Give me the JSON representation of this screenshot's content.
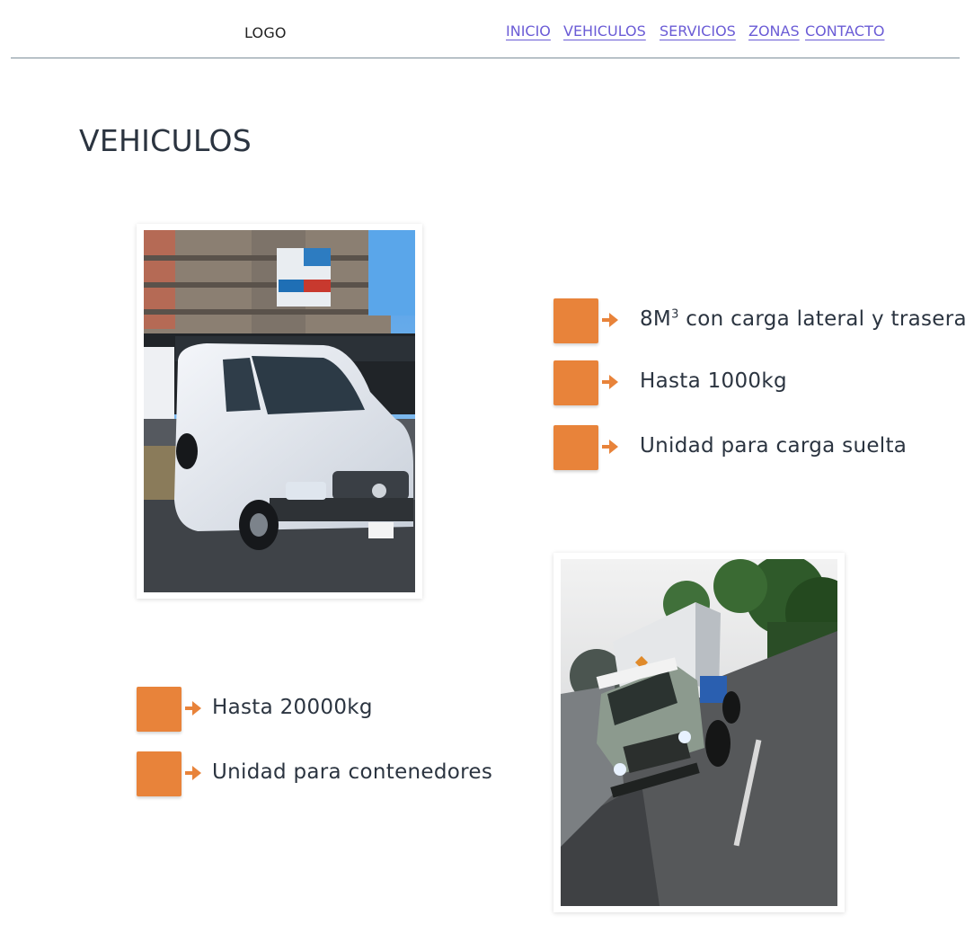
{
  "header": {
    "logo": "LOGO",
    "nav": [
      "INICIO",
      "VEHICULOS",
      "SERVICIOS",
      "ZONAS",
      "CONTACTO"
    ]
  },
  "main": {
    "title": "VEHICULOS",
    "vehicle1": {
      "features": [
        {
          "base": "8M",
          "sup": "3",
          "rest": " con carga lateral y trasera"
        },
        {
          "text": "Hasta 1000kg"
        },
        {
          "text": "Unidad para carga suelta"
        }
      ]
    },
    "vehicle2": {
      "features": [
        {
          "text": "Hasta 20000kg"
        },
        {
          "text": "Unidad para contenedores"
        }
      ]
    }
  },
  "colors": {
    "accent": "#e8833a",
    "link": "#6b5cd6",
    "text": "#2b3440"
  },
  "icons": [
    "arrow-right-icon"
  ]
}
